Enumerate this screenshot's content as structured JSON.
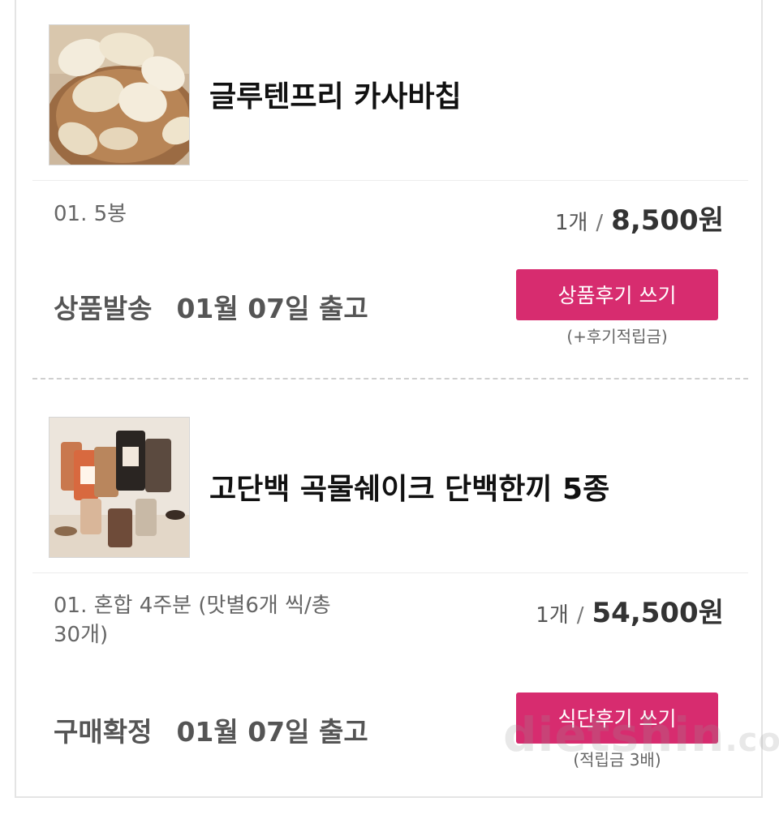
{
  "items": [
    {
      "title": "글루텐프리 카사바칩",
      "image_alt": "cassava chips in a wooden bowl",
      "option": "01. 5봉",
      "quantity": "1개",
      "slash": "/",
      "price": "8,500원",
      "status": "상품발송",
      "ship_date": "01월 07일 출고",
      "button_label": "상품후기 쓰기",
      "button_note": "(+후기적립금)"
    },
    {
      "title": "고단백 곡물쉐이크 단백한끼 5종",
      "image_alt": "protein grain shake pouches and cups",
      "option": "01. 혼합 4주분 (맛별6개 씩/총30개)",
      "quantity": "1개",
      "slash": "/",
      "price": "54,500원",
      "status": "구매확정",
      "ship_date": "01월 07일 출고",
      "button_label": "식단후기 쓰기",
      "button_note": "(적립금 3배)"
    }
  ],
  "watermark": {
    "text": "dietshin",
    "suffix": ".com"
  },
  "colors": {
    "accent": "#d72c6f",
    "border": "#e4e4e4"
  }
}
